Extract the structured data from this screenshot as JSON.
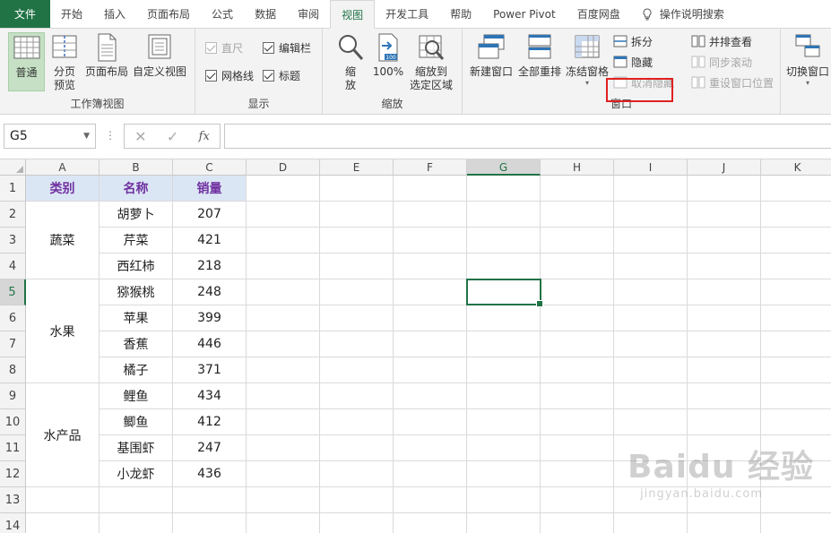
{
  "tabs": [
    {
      "label": "文件",
      "type": "file"
    },
    {
      "label": "开始"
    },
    {
      "label": "插入"
    },
    {
      "label": "页面布局"
    },
    {
      "label": "公式"
    },
    {
      "label": "数据"
    },
    {
      "label": "审阅"
    },
    {
      "label": "视图",
      "active": true
    },
    {
      "label": "开发工具"
    },
    {
      "label": "帮助"
    },
    {
      "label": "Power Pivot"
    },
    {
      "label": "百度网盘"
    },
    {
      "label": "操作说明搜索",
      "icon": "lightbulb-icon"
    }
  ],
  "ribbon": {
    "workbook_views": {
      "label": "工作簿视图",
      "normal": "普通",
      "page_break_1": "分页",
      "page_break_2": "预览",
      "page_layout": "页面布局",
      "custom_views": "自定义视图"
    },
    "show": {
      "label": "显示",
      "ruler": "直尺",
      "formula_bar": "编辑栏",
      "gridlines": "网格线",
      "headings": "标题"
    },
    "zoom": {
      "label": "缩放",
      "zoom_1": "缩",
      "zoom_2": "放",
      "hundred": "100%",
      "zoom_sel_1": "缩放到",
      "zoom_sel_2": "选定区域"
    },
    "window": {
      "label": "窗口",
      "new_window": "新建窗口",
      "arrange_all": "全部重排",
      "freeze_panes": "冻结窗格",
      "split": "拆分",
      "hide": "隐藏",
      "unhide": "取消隐藏",
      "side_by_side": "并排查看",
      "sync_scroll": "同步滚动",
      "reset_position": "重设窗口位置",
      "switch_windows": "切换窗口"
    }
  },
  "formula_bar": {
    "name_box": "G5",
    "fx": "fx",
    "formula": ""
  },
  "columns": [
    "A",
    "B",
    "C",
    "D",
    "E",
    "F",
    "G",
    "H",
    "I",
    "J",
    "K"
  ],
  "rows": [
    "1",
    "2",
    "3",
    "4",
    "5",
    "6",
    "7",
    "8",
    "9",
    "10",
    "11",
    "12",
    "13",
    "14"
  ],
  "table": {
    "headers": [
      "类别",
      "名称",
      "销量"
    ],
    "groups": [
      {
        "category": "蔬菜",
        "items": [
          [
            "胡萝卜",
            "207"
          ],
          [
            "芹菜",
            "421"
          ],
          [
            "西红柿",
            "218"
          ]
        ]
      },
      {
        "category": "水果",
        "items": [
          [
            "猕猴桃",
            "248"
          ],
          [
            "苹果",
            "399"
          ],
          [
            "香蕉",
            "446"
          ],
          [
            "橘子",
            "371"
          ]
        ]
      },
      {
        "category": "水产品",
        "items": [
          [
            "鲤鱼",
            "434"
          ],
          [
            "鲫鱼",
            "412"
          ],
          [
            "基围虾",
            "247"
          ],
          [
            "小龙虾",
            "436"
          ]
        ]
      }
    ]
  },
  "watermark": {
    "big": "Baidu 经验",
    "small": "jingyan.baidu.com"
  },
  "colors": {
    "accent": "#217346",
    "header_fill": "#dbe6f5",
    "header_text": "#7030a0",
    "highlight": "#e02020"
  }
}
